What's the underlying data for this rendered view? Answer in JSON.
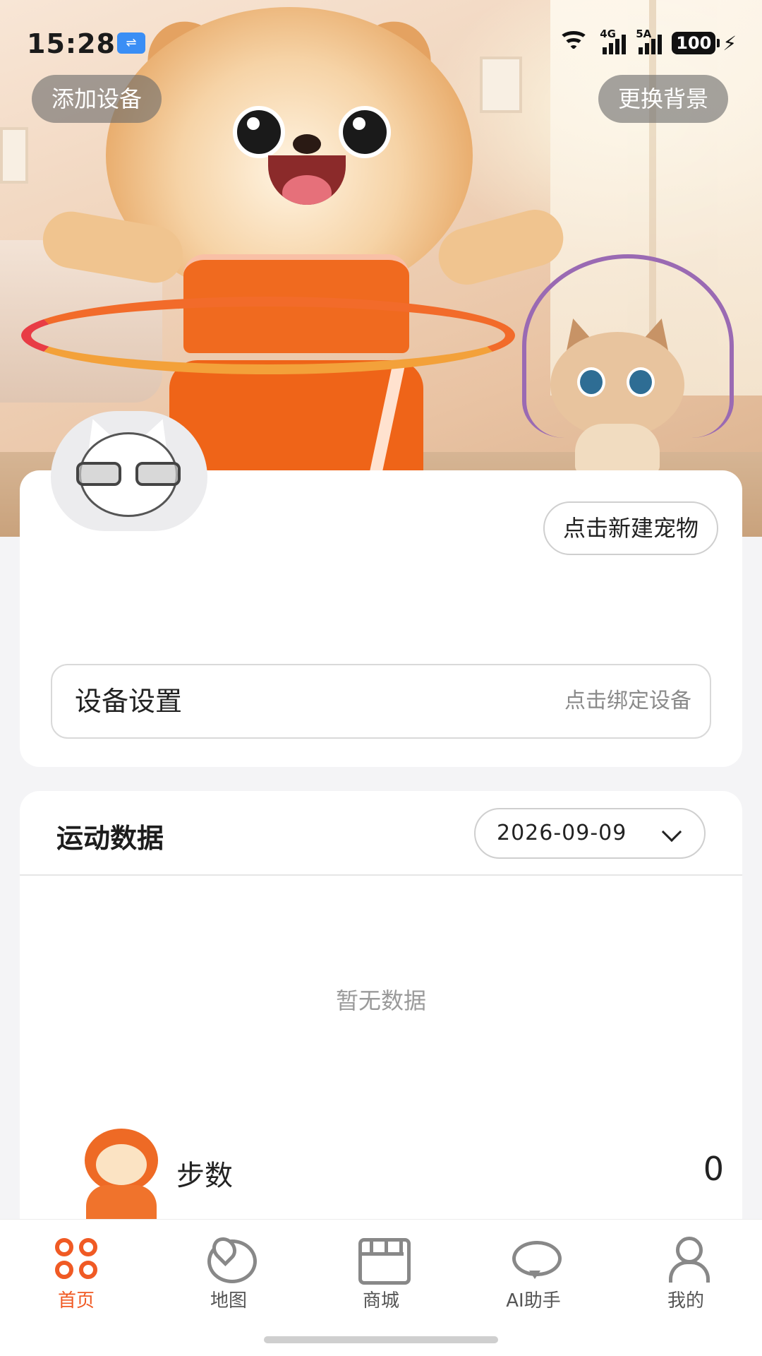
{
  "status_bar": {
    "time": "15:28",
    "usb_icon": "usb-icon",
    "network_1": "4G",
    "network_2": "5A",
    "battery": "100"
  },
  "hero": {
    "add_device": "添加设备",
    "change_background": "更换背景"
  },
  "pet_card": {
    "new_pet_button": "点击新建宠物",
    "device_settings_label": "设备设置",
    "device_settings_hint": "点击绑定设备"
  },
  "sport_card": {
    "title": "运动数据",
    "date": "2026-09-09",
    "empty_text": "暂无数据",
    "steps_label": "步数",
    "steps_value": "0"
  },
  "tabbar": {
    "tabs": [
      {
        "label": "首页",
        "icon": "home-icon",
        "active": true
      },
      {
        "label": "地图",
        "icon": "map-icon",
        "active": false
      },
      {
        "label": "商城",
        "icon": "shop-icon",
        "active": false
      },
      {
        "label": "AI助手",
        "icon": "chat-icon",
        "active": false
      },
      {
        "label": "我的",
        "icon": "user-icon",
        "active": false
      }
    ]
  },
  "colors": {
    "accent": "#f05a24",
    "background": "#f4f4f6",
    "card": "#ffffff"
  }
}
